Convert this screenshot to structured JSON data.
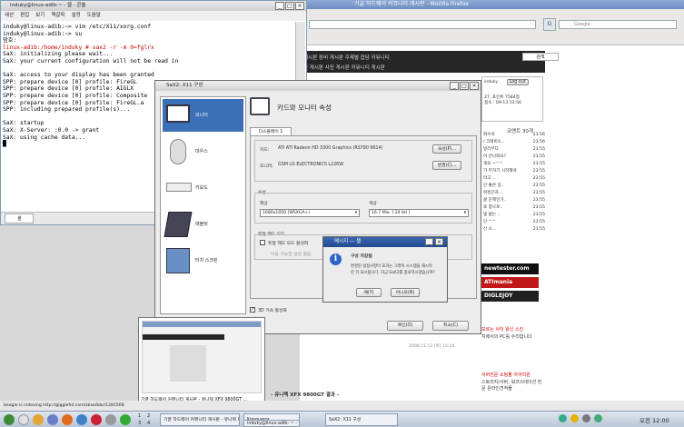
{
  "browser": {
    "title": "기글 하드웨어 커뮤니티 게시판 - Mozilla Firefox",
    "search_placeholder": "Google",
    "nav_row1": "게시판   장비 게시판   주제별 잡담   커뮤니티",
    "nav_row2": "한 게시판   사진 게시판   커뮤니티 게시판",
    "login_label": "Log out",
    "login_user": "induky",
    "login_line1": "27, 포인트 7584점",
    "login_line2": "접속 : 09-13 23:56",
    "sidebar_heading": "코멘트 30개",
    "sidebar_items": [
      "화수의",
      "/ 크레비오..",
      "빙리무다",
      "어 안나와요?",
      "게요 ~^^",
      "가 부하기 시작해야",
      "라고 ..",
      "인 좋은 용..",
      "피킹단과...",
      "꿀 문제인가..",
      "로 양으로..",
      "빛 없는 ..",
      "단 ^^",
      "신 소..."
    ],
    "sidebar_times": [
      "23:56",
      "23:56",
      "23:55",
      "23:55",
      "23:55",
      "23:55",
      "23:55",
      "23:55",
      "23:55",
      "23:55",
      "23:55",
      "23:55",
      "23:55",
      "23:55"
    ],
    "ad1": "newtester.com",
    "ad2": "ATImania",
    "ad3": "DIGLEJOY",
    "right_text1": "모르는 사이 왕신 스킨",
    "right_text2": "지에서의 PC를 수리합니다",
    "right_text3": "서버전문 쇼핑몰 아이티윈",
    "right_text4": "스토리지/서버, 워크스테이션 전문 온라인견적몰",
    "date": "2008.11.13 (목) 15:24",
    "colbox": "Lite ver"
  },
  "terminal": {
    "title": "induky@linux-adib:~ - 셸 - 콘솔",
    "menus": [
      "세션",
      "편집",
      "보기",
      "책갈피",
      "설정",
      "도움말"
    ],
    "lines": [
      {
        "t": "induky@linux-adib:~> vim /etc/X11/xorg.conf",
        "red": false
      },
      {
        "t": "induky@linux-adib:~> su",
        "red": false
      },
      {
        "t": "암호:",
        "red": false
      },
      {
        "t": "linux-adib:/home/induky # sax2 -r -m 0=fglrx",
        "red": true
      },
      {
        "t": "SaX: initializing please wait...",
        "red": false
      },
      {
        "t": "SaX: your current configuration will not be read in",
        "red": false
      },
      {
        "t": "",
        "red": false
      },
      {
        "t": "SaX: access to your display has been granted",
        "red": false
      },
      {
        "t": "SPP: prepare device [0] profile: FireGL",
        "red": false
      },
      {
        "t": "SPP: prepare device [0] profile: AIGLX",
        "red": false
      },
      {
        "t": "SPP: prepare device [0] profile: Composite",
        "red": false
      },
      {
        "t": "SPP: prepare device [0] profile: FireGL.a",
        "red": false
      },
      {
        "t": "SPP: including prepared profile(s)...",
        "red": false
      },
      {
        "t": "",
        "red": false
      },
      {
        "t": "SaX: startup",
        "red": false
      },
      {
        "t": "SaX: X-Server: :0.0 -> grant",
        "red": false
      },
      {
        "t": "SaX: using cache data...",
        "red": false
      },
      {
        "t": "█",
        "red": false
      }
    ],
    "tab_label": "셸"
  },
  "sax": {
    "title": "SaX2: X11 구성",
    "side_items": [
      "모니터",
      "마우스",
      "키보드",
      "태블릿",
      "터치 스크린"
    ],
    "heading": "카드와 모니터 속성",
    "tab": "디스플레이 1",
    "card_label": "카드:",
    "card_value": "ATI ATI Radeon HD 3300 Graphics (RS780 9614)",
    "monitor_label": "모니터:",
    "monitor_value": "GSM LG ELECTRONICS L226W",
    "props_button": "속성(P)...",
    "change_button": "변경(C)...",
    "attr_group": "속성",
    "res_label": "해상",
    "res_value": "1680x1050 (WSXGA+)",
    "color_label": "색상",
    "color_value": "16.7 Mio. [ 24 bit ]",
    "dual_group": "듀얼 헤드 모드",
    "dual_check": "듀얼 헤드 모드 활성화",
    "dual_sub": "이용 가능한 설정 없음",
    "threed_check": "3D 가속 활성화",
    "ok_button": "확인(O)",
    "cancel_button": "취소(C)"
  },
  "message": {
    "title": "메시지 — 셸",
    "heading": "구성 저장됨",
    "body1": "변경된 설정사항이 효과는 그래픽 시스템을 재시작",
    "body2": "한 뒤 표시됩니다. 지금 SaX2를 종료하시겠습니까?",
    "yes_button": "예(Y)",
    "no_button": "아니오(N)"
  },
  "thumbnail": {
    "caption": "기글 하드웨어 커뮤니티 게시판 - 유니텍 XFX 9800GT ...",
    "outside_caption": "- 유니텍 XFX 9800GT 결과 -"
  },
  "status": "beagle is indexing http://gigglehd.com/zbxe/bbs/1281508",
  "taskbar": {
    "tasks": [
      "기글 하드웨어 커뮤니티 게시판 - 유니텍 XFX 9800GT ...",
      "Konqueror",
      "induky@linux-adib: ~ - 셸 - 콘솔",
      "SaX2: X11 구성"
    ],
    "desk_nums": [
      "1",
      "2",
      "3",
      "4"
    ],
    "clock": "오전 12:00"
  }
}
